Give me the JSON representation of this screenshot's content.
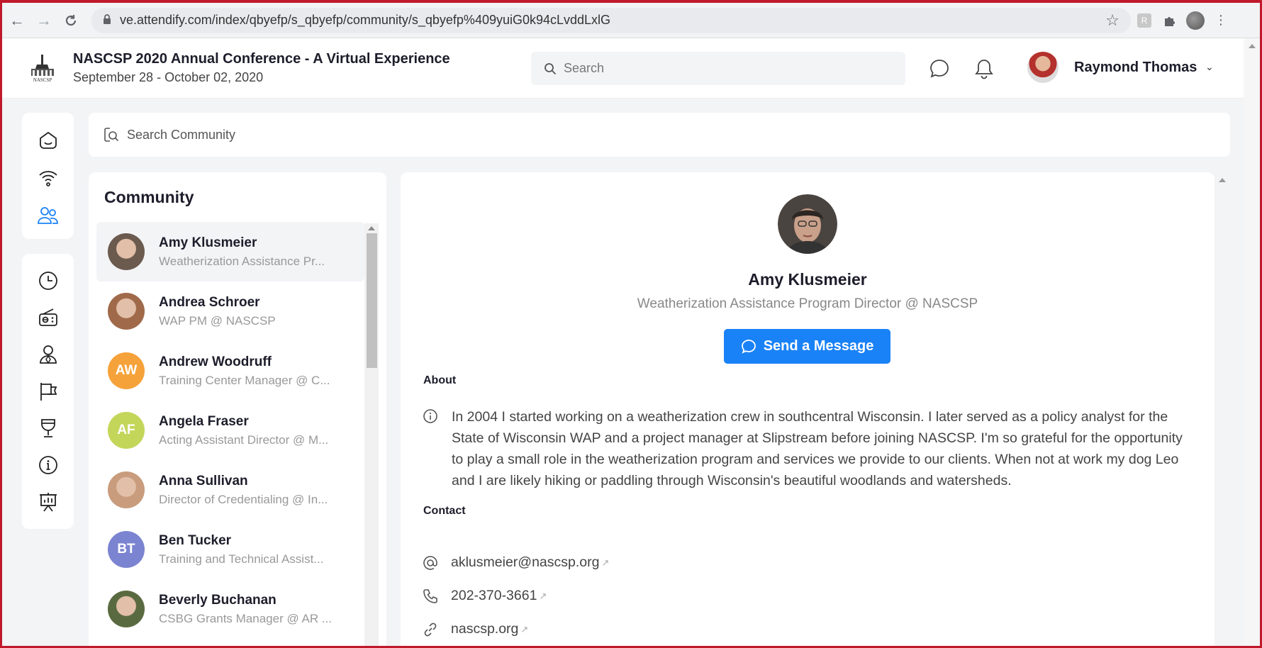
{
  "browser": {
    "url": "ve.attendify.com/index/qbyefp/s_qbyefp/community/s_qbyefp%409yuiG0k94cLvddLxlG"
  },
  "header": {
    "conference_title": "NASCSP 2020 Annual Conference - A Virtual Experience",
    "conference_dates": "September 28 - October 02, 2020",
    "logo_text": "NASCSP",
    "search_placeholder": "Search",
    "user_name": "Raymond Thomas"
  },
  "community": {
    "search_placeholder": "Search Community",
    "title": "Community",
    "people": [
      {
        "name": "Amy Klusmeier",
        "role": "Weatherization Assistance Pr...",
        "initials": "",
        "color": "#6b5a4e",
        "active": true
      },
      {
        "name": "Andrea Schroer",
        "role": "WAP PM @ NASCSP",
        "initials": "",
        "color": "#a06a4a",
        "active": false
      },
      {
        "name": "Andrew Woodruff",
        "role": "Training Center Manager @ C...",
        "initials": "AW",
        "color": "#f5a23a",
        "active": false
      },
      {
        "name": "Angela Fraser",
        "role": "Acting Assistant Director @ M...",
        "initials": "AF",
        "color": "#c4d65a",
        "active": false
      },
      {
        "name": "Anna Sullivan",
        "role": "Director of Credentialing @ In...",
        "initials": "",
        "color": "#c89c7c",
        "active": false
      },
      {
        "name": "Ben Tucker",
        "role": "Training and Technical Assist...",
        "initials": "BT",
        "color": "#7b84d0",
        "active": false
      },
      {
        "name": "Beverly Buchanan",
        "role": "CSBG Grants Manager @ AR ...",
        "initials": "",
        "color": "#5a6a40",
        "active": false
      }
    ]
  },
  "profile": {
    "name": "Amy Klusmeier",
    "title": "Weatherization Assistance Program Director @ NASCSP",
    "message_button": "Send a Message",
    "about_label": "About",
    "about_text": "In 2004 I started working on a weatherization crew in southcentral Wisconsin. I later served as a policy analyst for the State of Wisconsin WAP and a project manager at Slipstream before joining NASCSP. I'm so grateful for the opportunity to play a small role in the weatherization program and services we provide to our clients. When not at work my dog Leo and I are likely hiking or paddling through Wisconsin's beautiful woodlands and watersheds.",
    "contact_label": "Contact",
    "email": "aklusmeier@nascsp.org",
    "phone": "202-370-3661",
    "website": "nascsp.org"
  },
  "colors": {
    "accent": "#1a82f7",
    "active_nav": "#1a82f7",
    "frame": "#c0192b"
  },
  "icons": {
    "rail_top": [
      "home-icon",
      "live-stream-icon",
      "community-icon"
    ],
    "rail_bottom": [
      "schedule-icon",
      "radio-icon",
      "speakers-icon",
      "exhibitors-icon",
      "sponsors-icon",
      "info-icon",
      "presentation-icon"
    ]
  }
}
